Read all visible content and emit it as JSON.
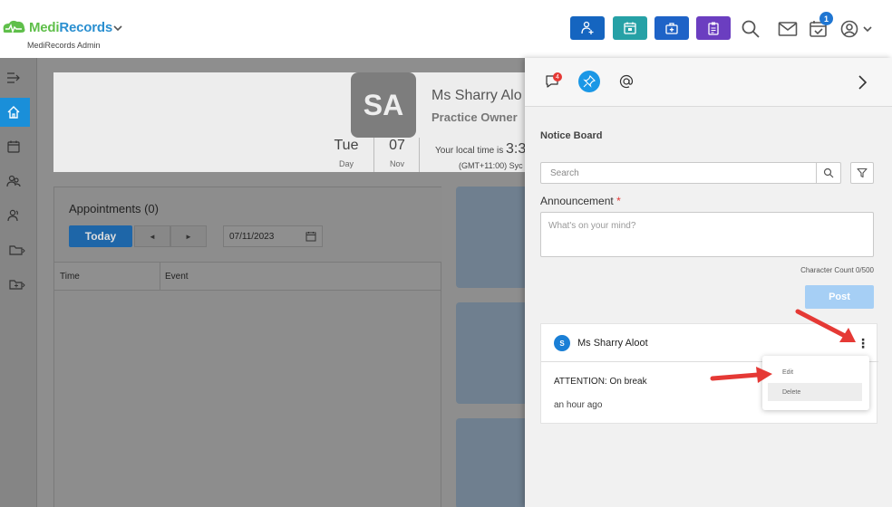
{
  "header": {
    "brand_medi": "Medi",
    "brand_records": "Records",
    "subtitle": "MediRecords Admin",
    "notification_count": "1",
    "toolbar_buttons": [
      {
        "name": "add-patient",
        "color": "#1565c0"
      },
      {
        "name": "appointment",
        "color": "#26a1a6"
      },
      {
        "name": "medical-kit",
        "color": "#1e63c7"
      },
      {
        "name": "clipboard",
        "color": "#6b3ec0"
      }
    ]
  },
  "profile": {
    "initials": "SA",
    "name": "Ms Sharry Alo",
    "role": "Practice Owner",
    "day_name": "Tue",
    "day_label": "Day",
    "date_num": "07",
    "month_label": "Nov",
    "local_time_prefix": "Your local time is",
    "local_time_value": "3:3",
    "timezone": "(GMT+11:00) Syc"
  },
  "appointments": {
    "title": "Appointments (0)",
    "today_label": "Today",
    "prev_label": "◄",
    "next_label": "►",
    "date_value": "07/11/2023",
    "columns": [
      "Time",
      "Event"
    ]
  },
  "drawer": {
    "chat_badge": "4",
    "notice_board_title": "Notice Board",
    "search_placeholder": "Search",
    "announcement_label": "Announcement",
    "required_mark": "*",
    "announcement_placeholder": "What's on your mind?",
    "char_count": "Character Count 0/500",
    "post_label": "Post",
    "accent": "#1a97e6"
  },
  "post": {
    "avatar_letter": "S",
    "author": "Ms Sharry Aloot",
    "more_icon": "⋮",
    "message": "ATTENTION: On break",
    "time": "an hour ago",
    "menu": [
      "Edit",
      "Delete"
    ]
  }
}
